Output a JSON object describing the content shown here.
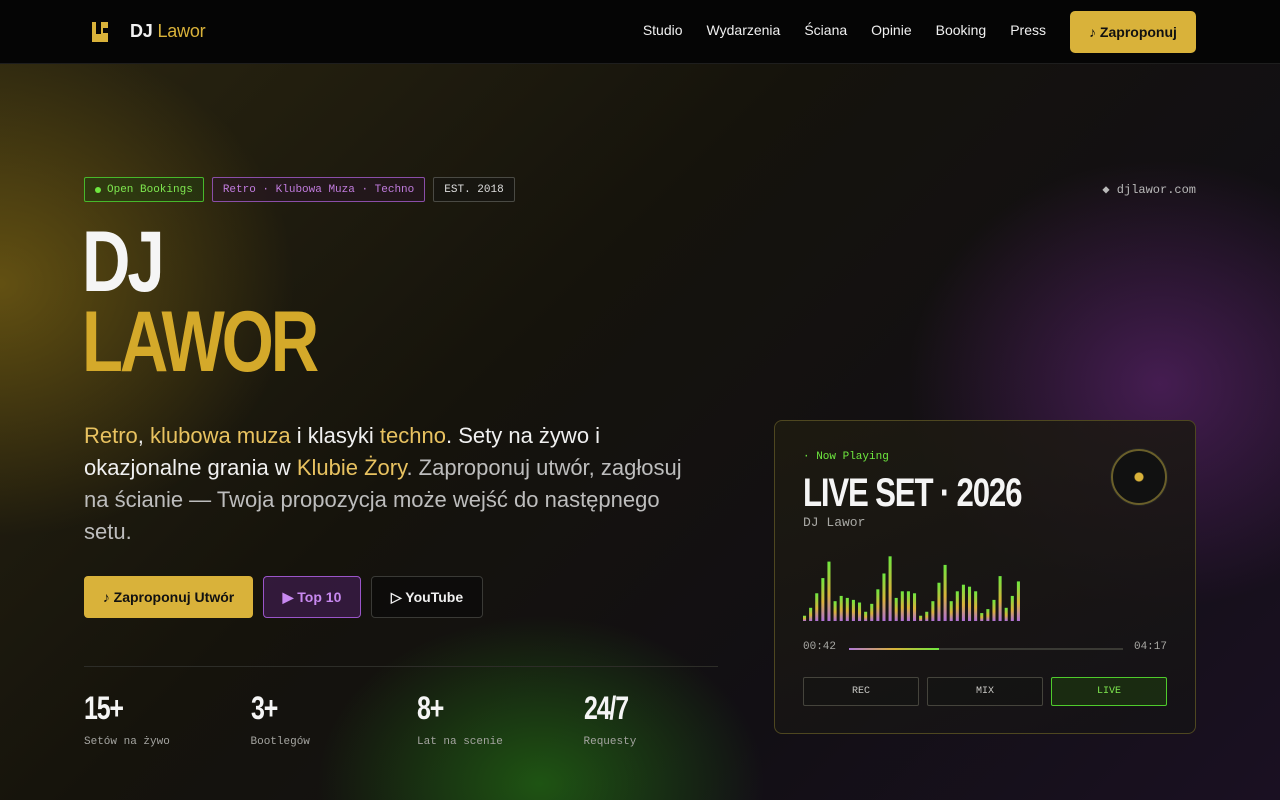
{
  "nav": {
    "brand_first": "DJ",
    "brand_second": "Lawor",
    "links": [
      "Studio",
      "Wydarzenia",
      "Ściana",
      "Opinie",
      "Booking",
      "Press"
    ],
    "cta": "♪ Zaproponuj",
    "colors": {
      "accent": "#d9b23a",
      "background": "#050505"
    }
  },
  "hero": {
    "tags": [
      "Open Bookings",
      "Retro · Klubowa Muza · Techno",
      "EST. 2018"
    ],
    "site": "◆ djlawor.com",
    "title_line1": "DJ",
    "title_line2": "LAWOR",
    "desc": {
      "p1": "Retro",
      "p2": ", ",
      "p3": "klubowa muza",
      "p4": " i klasyki ",
      "p5": "techno",
      "p6": ". Sety na żywo i okazjonalne grania w ",
      "p7": "Klubie Żory",
      "p8": ". Zaproponuj utwór, zagłosuj na ścianie — Twoja propozycja może wejść do następnego setu."
    },
    "buttons": {
      "primary": "♪ Zaproponuj Utwór",
      "top10": "▶ Top 10",
      "youtube": "▷ YouTube"
    },
    "stats": [
      {
        "value": "15+",
        "label": "Setów na żywo"
      },
      {
        "value": "3+",
        "label": "Bootlegów"
      },
      {
        "value": "8+",
        "label": "Lat na scenie"
      },
      {
        "value": "24/7",
        "label": "Requesty"
      }
    ]
  },
  "player": {
    "status": "· Now Playing",
    "title": "LIVE SET · 2026",
    "artist": "DJ Lawor",
    "elapsed": "00:42",
    "duration": "04:17",
    "progress": 0.33,
    "controls": [
      "REC",
      "MIX",
      "LIVE"
    ],
    "active_control": "LIVE",
    "visualizer_levels": [
      0.08,
      0.2,
      0.42,
      0.65,
      0.9,
      0.3,
      0.38,
      0.35,
      0.32,
      0.28,
      0.14,
      0.26,
      0.48,
      0.72,
      0.98,
      0.35,
      0.45,
      0.45,
      0.42,
      0.08,
      0.14,
      0.3,
      0.58,
      0.85,
      0.3,
      0.45,
      0.55,
      0.52,
      0.45,
      0.12,
      0.18,
      0.32,
      0.68,
      0.2,
      0.38,
      0.6
    ],
    "visualizer_colors": {
      "top": "#6ee83f",
      "mid": "#d9b23a",
      "bottom": "#b070d8"
    }
  }
}
